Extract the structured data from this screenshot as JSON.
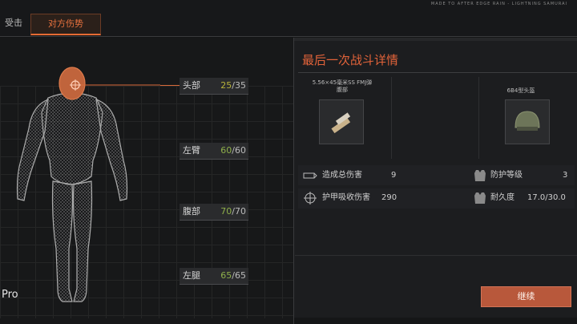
{
  "tabs": {
    "hit": "受击",
    "enemy": "对方伤势"
  },
  "corner_text": "MADE TO AFTER EDGE RAIN - LIGHTNING SAMURAI",
  "body_parts": [
    {
      "label": "头部",
      "current": "25",
      "max": "/35"
    },
    {
      "label": "左臂",
      "current": "60",
      "max": "/60"
    },
    {
      "label": "腹部",
      "current": "70",
      "max": "/70"
    },
    {
      "label": "左腿",
      "current": "65",
      "max": "/65"
    }
  ],
  "device_label": "Pro",
  "details": {
    "title": "最后一次战斗详情",
    "weapon_name": "5.56×45毫米SS FMJ弹",
    "weapon_name2": "腹部",
    "helmet_name": "6B4型头盔",
    "stats": [
      {
        "label": "造成总伤害",
        "value": "9",
        "icon": "ammo-icon"
      },
      {
        "label": "护甲吸收伤害",
        "value": "290",
        "icon": "crosshair-icon"
      }
    ],
    "armor_stats": [
      {
        "label": "防护等级",
        "value": "3",
        "icon": "vest-icon"
      },
      {
        "label": "耐久度",
        "value": "17.0/30.0",
        "icon": "vest-icon"
      }
    ]
  },
  "continue_label": "继续",
  "colors": {
    "accent": "#e2633a",
    "button": "#b8583b",
    "hurt": "#b9b33a",
    "healthy": "#8fb04a"
  }
}
